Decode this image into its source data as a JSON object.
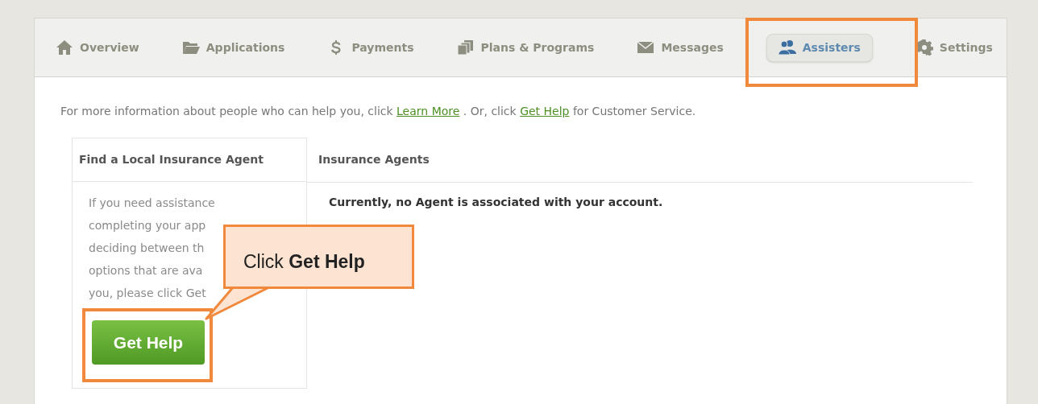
{
  "tabs": [
    {
      "label": "Overview",
      "selected": false
    },
    {
      "label": "Applications",
      "selected": false
    },
    {
      "label": "Payments",
      "selected": false
    },
    {
      "label": "Plans & Programs",
      "selected": false
    },
    {
      "label": "Messages",
      "selected": false
    },
    {
      "label": "Assisters",
      "selected": true
    },
    {
      "label": "Settings",
      "selected": false
    }
  ],
  "info": {
    "before": "For more information about people who can help you, click",
    "link_1": "Learn More",
    "middle": ". Or, click",
    "link_2": "Get Help",
    "after": "for Customer Service."
  },
  "find_agent": {
    "heading": "Find a Local Insurance Agent",
    "text_lines": [
      "If you need assistance",
      "completing your app",
      "deciding between th",
      "options that are ava",
      "you, please click Get"
    ],
    "button": "Get Help"
  },
  "insurance_agents": {
    "heading": "Insurance Agents",
    "message": "Currently, no Agent is associated with your account."
  },
  "annotations": {
    "callout": "Click **Get Help**"
  }
}
